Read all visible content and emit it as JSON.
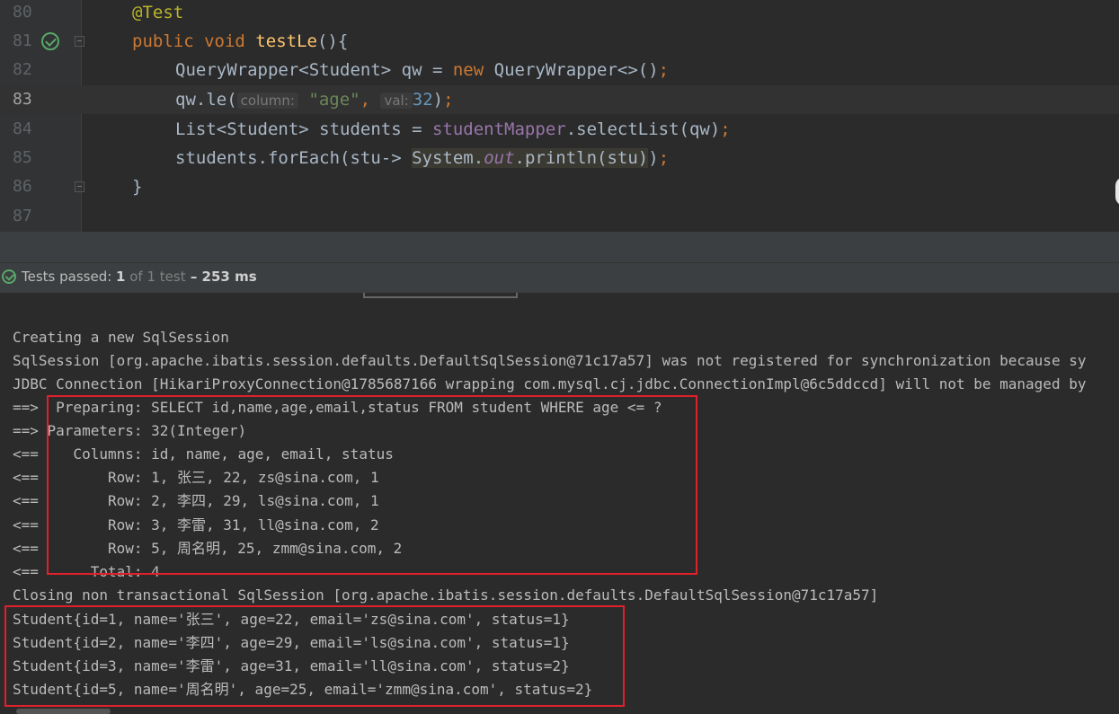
{
  "editor": {
    "lines": [
      {
        "num": "80"
      },
      {
        "num": "81"
      },
      {
        "num": "82"
      },
      {
        "num": "83"
      },
      {
        "num": "84"
      },
      {
        "num": "85"
      },
      {
        "num": "86"
      },
      {
        "num": "87"
      }
    ],
    "code": {
      "annotation": "@Test",
      "kw_public": "public",
      "kw_void": "void",
      "method_name": "testLe",
      "method_tail": "(){",
      "l82_a": "QueryWrapper<Student> qw = ",
      "kw_new": "new",
      "l82_b": " QueryWrapper<>()",
      "semicolon": ";",
      "l83_a": "qw.le(",
      "hint_column": "column:",
      "str_age": "\"age\"",
      "comma": ",",
      "hint_val": "val:",
      "num_32": "32",
      "l83_close": ")",
      "l84_a": "List<Student> students = ",
      "field_mapper": "studentMapper",
      "l84_b": ".selectList(qw)",
      "l85_a": "students.forEach(stu-> ",
      "sys": "System.",
      "out": "out",
      "println": ".println(stu)",
      "l85_close": ")",
      "l86_brace": "}"
    }
  },
  "status": {
    "prefix": "Tests passed: ",
    "passed": "1",
    "of_label": " of 1 test",
    "duration": " – 253 ms"
  },
  "console": {
    "lines": [
      "Creating a new SqlSession",
      "SqlSession [org.apache.ibatis.session.defaults.DefaultSqlSession@71c17a57] was not registered for synchronization because sy",
      "JDBC Connection [HikariProxyConnection@1785687166 wrapping com.mysql.cj.jdbc.ConnectionImpl@6c5ddccd] will not be managed by",
      "==>  Preparing: SELECT id,name,age,email,status FROM student WHERE age <= ?",
      "==> Parameters: 32(Integer)",
      "<==    Columns: id, name, age, email, status",
      "<==        Row: 1, 张三, 22, zs@sina.com, 1",
      "<==        Row: 2, 李四, 29, ls@sina.com, 1",
      "<==        Row: 3, 李雷, 31, ll@sina.com, 2",
      "<==        Row: 5, 周名明, 25, zmm@sina.com, 2",
      "<==      Total: 4",
      "Closing non transactional SqlSession [org.apache.ibatis.session.defaults.DefaultSqlSession@71c17a57]",
      "Student{id=1, name='张三', age=22, email='zs@sina.com', status=1}",
      "Student{id=2, name='李四', age=29, email='ls@sina.com', status=1}",
      "Student{id=3, name='李雷', age=31, email='ll@sina.com', status=2}",
      "Student{id=5, name='周名明', age=25, email='zmm@sina.com', status=2}"
    ]
  }
}
